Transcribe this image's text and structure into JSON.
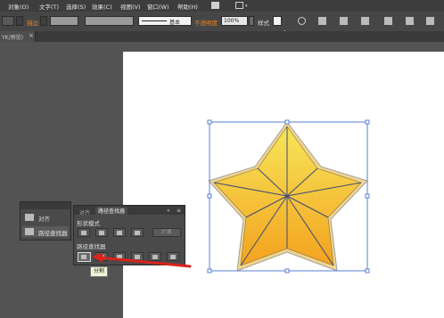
{
  "menu": {
    "items": [
      "对象(O)",
      "文字(T)",
      "选择(S)",
      "效果(C)",
      "视图(V)",
      "窗口(W)",
      "帮助(H)"
    ]
  },
  "control_bar": {
    "label_desc": "描边",
    "stroke_style": "基本",
    "opacity_label": "不透明度",
    "opacity_value": "100%",
    "style_label": "样式"
  },
  "document": {
    "tab_label": "YK/预览)"
  },
  "align_panel": {
    "items": [
      "对齐",
      "路径查找器"
    ]
  },
  "pathfinder_panel": {
    "tabs": [
      "对齐",
      "路径查找器"
    ],
    "shape_modes_label": "形状模式",
    "expand_label": "扩展",
    "pathfinders_label": "路径查找器",
    "tooltip": "分割"
  },
  "colors": {
    "accent_orange": "#e8831e",
    "arrow_red": "#d9231b",
    "selection_blue": "#5a7fd6",
    "star_top": "#f6e65a",
    "star_bottom": "#f4a21e"
  }
}
